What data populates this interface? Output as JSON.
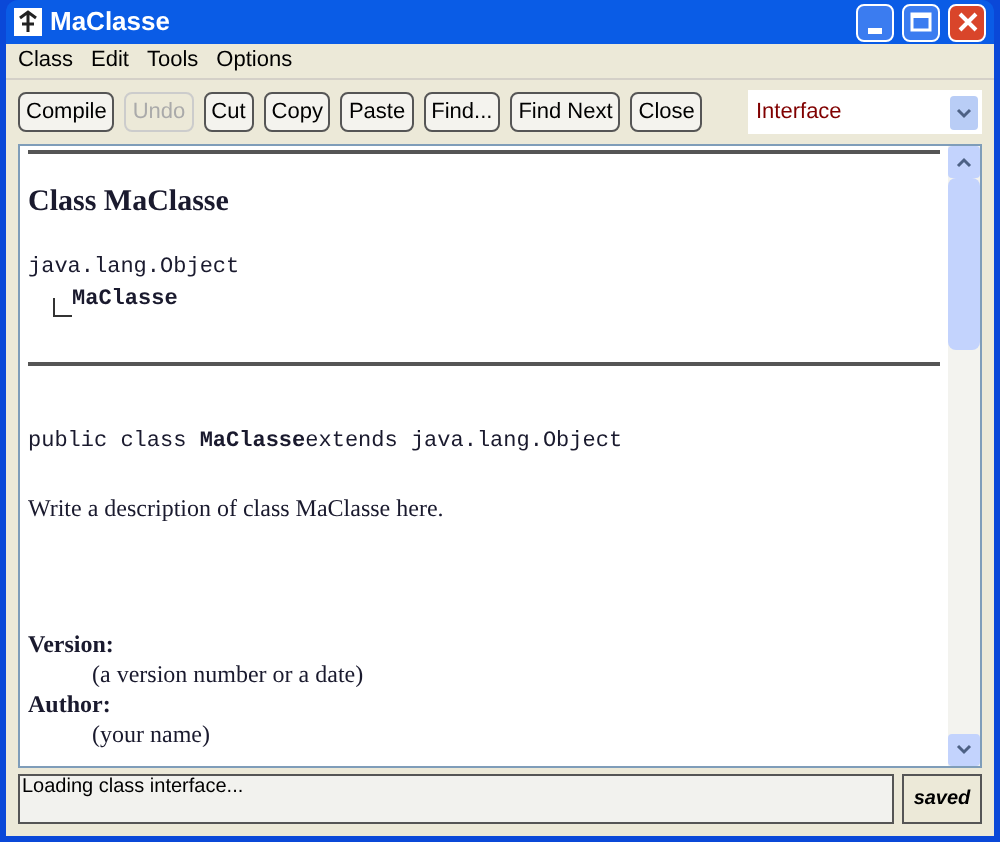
{
  "window": {
    "title": "MaClasse"
  },
  "menu": [
    "Class",
    "Edit",
    "Tools",
    "Options"
  ],
  "toolbar": [
    {
      "label": "Compile",
      "disabled": false
    },
    {
      "label": "Undo",
      "disabled": true
    },
    {
      "label": "Cut",
      "disabled": false
    },
    {
      "label": "Copy",
      "disabled": false
    },
    {
      "label": "Paste",
      "disabled": false
    },
    {
      "label": "Find...",
      "disabled": false
    },
    {
      "label": "Find Next",
      "disabled": false
    },
    {
      "label": "Close",
      "disabled": false
    }
  ],
  "view_select": {
    "value": "Interface"
  },
  "document": {
    "heading": "Class MaClasse",
    "superclass": "java.lang.Object",
    "class_name": "MaClasse",
    "declaration": "public class **MaClasse**extends java.lang.Object",
    "description": "Write a description of class MaClasse here.",
    "tags": [
      {
        "label": "Version:",
        "value": "(a version number or a date)"
      },
      {
        "label": "Author:",
        "value": "(your name)"
      }
    ]
  },
  "status_bar": {
    "message": "Loading class interface...",
    "state": "saved"
  }
}
